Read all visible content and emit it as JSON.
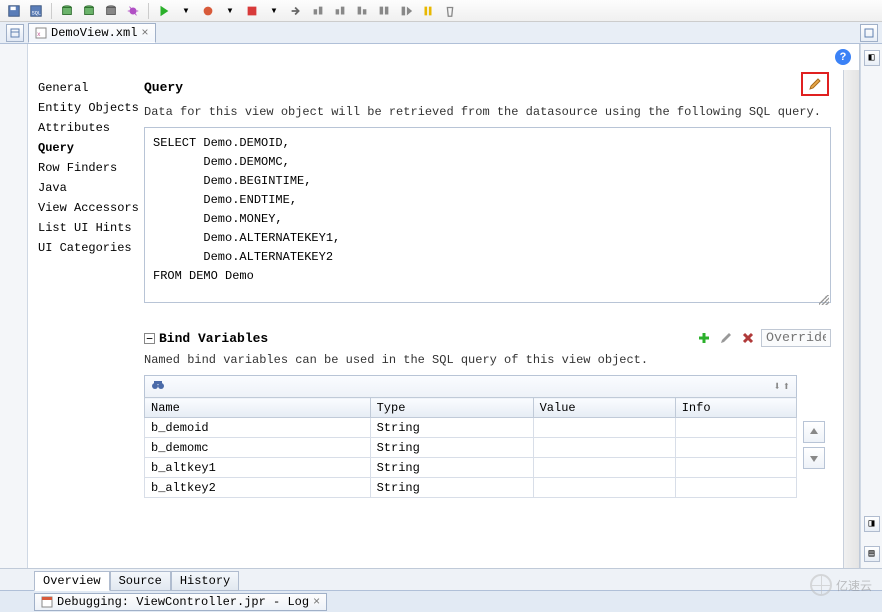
{
  "toolbar_tips": {
    "save": "Save",
    "save_all": "Save All",
    "db1": "DB action 1",
    "db2": "DB action 2",
    "db3": "DB action 3",
    "bug": "Bug",
    "run": "Run",
    "debug": "Debug Run",
    "stop": "Stop",
    "step": "Step",
    "step_over": "Step Over",
    "step_into": "Step Into",
    "step_out": "Step Out",
    "resume": "Resume",
    "pause": "Pause",
    "end": "End",
    "gc": "GC"
  },
  "file_tab": {
    "label": "DemoView.xml"
  },
  "nav": {
    "items": [
      "General",
      "Entity Objects",
      "Attributes",
      "Query",
      "Row Finders",
      "Java",
      "View Accessors",
      "List UI Hints",
      "UI Categories"
    ],
    "active_index": 3
  },
  "query": {
    "title": "Query",
    "desc": "Data for this view object will be retrieved from the datasource using the following SQL query.",
    "sql": "SELECT Demo.DEMOID,\n       Demo.DEMOMC,\n       Demo.BEGINTIME,\n       Demo.ENDTIME,\n       Demo.MONEY,\n       Demo.ALTERNATEKEY1,\n       Demo.ALTERNATEKEY2\nFROM DEMO Demo"
  },
  "bind": {
    "title": "Bind Variables",
    "desc": "Named bind variables can be used in the SQL query of this view object.",
    "override_placeholder": "Override…",
    "columns": [
      "Name",
      "Type",
      "Value",
      "Info"
    ],
    "rows": [
      {
        "name": "b_demoid",
        "type": "String",
        "value": "",
        "info": ""
      },
      {
        "name": "b_demomc",
        "type": "String",
        "value": "",
        "info": ""
      },
      {
        "name": "b_altkey1",
        "type": "String",
        "value": "",
        "info": ""
      },
      {
        "name": "b_altkey2",
        "type": "String",
        "value": "",
        "info": ""
      }
    ]
  },
  "bottom_tabs": {
    "items": [
      "Overview",
      "Source",
      "History"
    ],
    "active_index": 0
  },
  "log_tab": {
    "label": "Debugging: ViewController.jpr - Log"
  },
  "watermark": "亿速云"
}
